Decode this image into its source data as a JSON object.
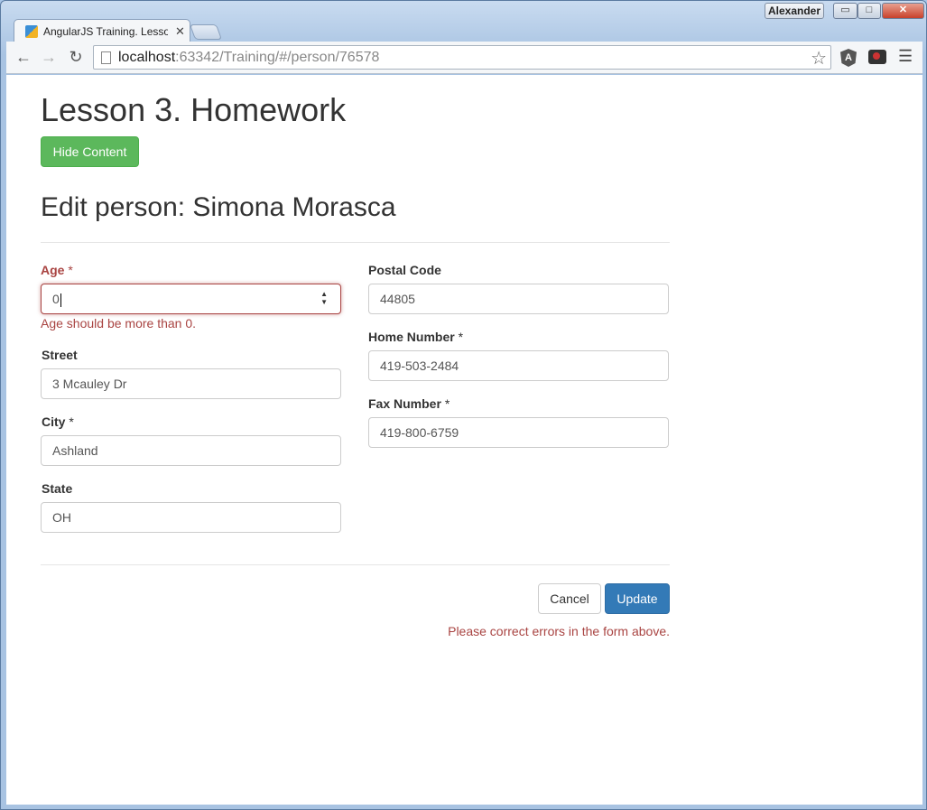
{
  "window": {
    "user": "Alexander",
    "minimize": "▭",
    "maximize": "□",
    "close": "✕"
  },
  "browser": {
    "tab_title": "AngularJS Training. Lesson",
    "tab_close": "✕",
    "url_host": "localhost",
    "url_path": ":63342/Training/#/person/76578",
    "extension_angular": "A"
  },
  "page": {
    "heading": "Lesson 3. Homework",
    "hide_button": "Hide Content",
    "edit_title": "Edit person: Simona Morasca"
  },
  "form": {
    "age": {
      "label": "Age",
      "required": "*",
      "value": "0",
      "error": "Age should be more than 0."
    },
    "street": {
      "label": "Street",
      "value": "3 Mcauley Dr"
    },
    "city": {
      "label": "City",
      "required": "*",
      "value": "Ashland"
    },
    "state": {
      "label": "State",
      "value": "OH"
    },
    "postal_code": {
      "label": "Postal Code",
      "value": "44805"
    },
    "home_number": {
      "label": "Home Number",
      "required": "*",
      "value": "419-503-2484"
    },
    "fax_number": {
      "label": "Fax Number",
      "required": "*",
      "value": "419-800-6759"
    }
  },
  "actions": {
    "cancel": "Cancel",
    "update": "Update",
    "form_error": "Please correct errors in the form above."
  },
  "colors": {
    "success": "#5cb85c",
    "primary": "#337ab7",
    "danger": "#a94442"
  }
}
